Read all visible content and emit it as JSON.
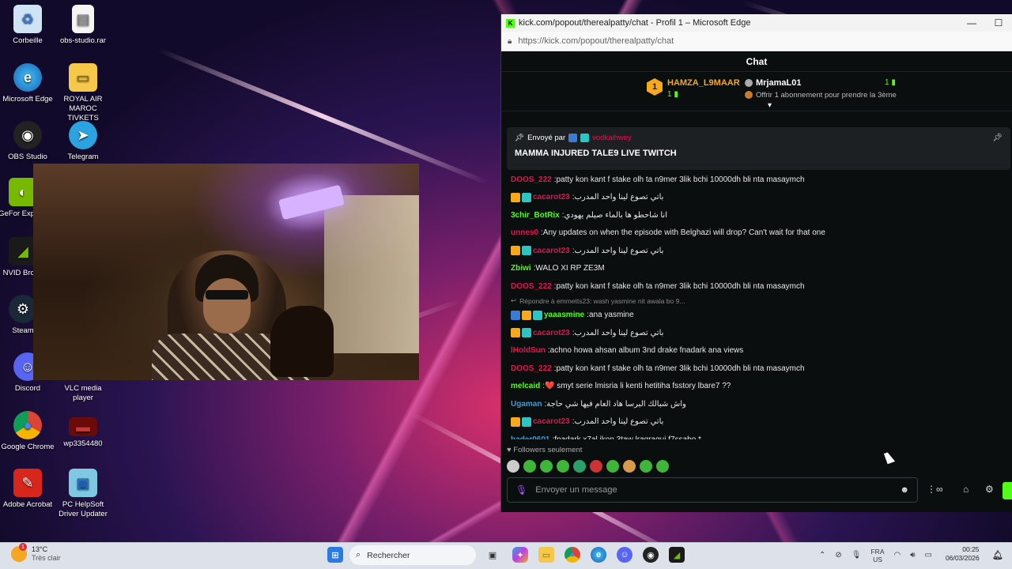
{
  "desktop_icons": [
    {
      "label": "Corbeille"
    },
    {
      "label": "obs-studio.rar"
    },
    {
      "label": "Microsoft Edge"
    },
    {
      "label": "ROYAL AIR MAROC TIVKETS"
    },
    {
      "label": "OBS Studio"
    },
    {
      "label": "Telegram"
    },
    {
      "label": "GeFor Experie"
    },
    {
      "label": "NVID Broad"
    },
    {
      "label": "Steam"
    },
    {
      "label": "Discord"
    },
    {
      "label": "VLC media player"
    },
    {
      "label": "Google Chrome"
    },
    {
      "label": "wp3354480"
    },
    {
      "label": "Adobe Acrobat"
    },
    {
      "label": "PC HelpSoft Driver Updater"
    }
  ],
  "window": {
    "title": "kick.com/popout/therealpatty/chat - Profil 1 – Microsoft Edge",
    "url": "https://kick.com/popout/therealpatty/chat",
    "minimize": "—",
    "maximize": "☐"
  },
  "chat": {
    "header": "Chat",
    "leaderboard": {
      "first_rank": "1",
      "first_name": "HAMZA_L9MAAR",
      "first_count": "1",
      "second_name": "MrjamaL01",
      "second_count": "1",
      "offer_text": "Offrir 1 abonnement pour prendre la 3ème"
    },
    "pinned": {
      "sent_by": "Envoyé par",
      "user": "vodkaihwey",
      "message": "MAMMA INJURED TALE9 LIVE TWITCH"
    },
    "messages": [
      {
        "user": "DOOS_222",
        "color": "#e9114f",
        "badges": [],
        "text": "patty kon kant f stake olh ta n9mer 3lik bchi 10000dh bli nta masaymch"
      },
      {
        "user": "cacarot23",
        "color": "#e9114f",
        "badges": [
          "#f7a81b",
          "#2ec4c4"
        ],
        "text": "باتي تصوع لينا واحد المدرب"
      },
      {
        "user": "3chir_BotRix",
        "color": "#53fc18",
        "badges": [],
        "text": "انا شاحطو ها بالماء صيلم يهودي"
      },
      {
        "user": "unnes0",
        "color": "#e9114f",
        "badges": [],
        "text": "Any updates on when the episode with Belghazi will drop? Can't wait for that one"
      },
      {
        "user": "cacarot23",
        "color": "#e9114f",
        "badges": [
          "#f7a81b",
          "#2ec4c4"
        ],
        "text": "باتي تصوع لينا واحد المدرب"
      },
      {
        "user": "Zbiwi",
        "color": "#53fc18",
        "badges": [],
        "text": "WALO XI RP ZE3M"
      },
      {
        "user": "DOOS_222",
        "color": "#e9114f",
        "badges": [],
        "text": "patty kon kant f stake olh ta n9mer 3lik bchi 10000dh bli nta masaymch"
      }
    ],
    "reply_line": "Répondre à emmetts23: wash yasmine nit awala bo 9...",
    "messages2": [
      {
        "user": "yaaasmine",
        "color": "#53fc18",
        "badges": [
          "#3a7bd5",
          "#f7a81b",
          "#2ec4c4"
        ],
        "text": "ana yasmine"
      },
      {
        "user": "cacarot23",
        "color": "#e9114f",
        "badges": [
          "#f7a81b",
          "#2ec4c4"
        ],
        "text": "باتي تصوع لينا واحد المدرب"
      },
      {
        "user": "lHoldSun",
        "color": "#e9114f",
        "badges": [],
        "text": "achno howa ahsan album 3nd drake fnadark ana views"
      },
      {
        "user": "DOOS_222",
        "color": "#e9114f",
        "badges": [],
        "text": "patty kon kant f stake olh ta n9mer 3lik bchi 10000dh bli nta masaymch"
      },
      {
        "user": "melcaid",
        "color": "#53fc18",
        "badges": [],
        "text": " ❤️ smyt serie lmisria li kenti hetitiha fsstory lbare7 ??"
      },
      {
        "user": "Ugaman",
        "color": "#3a9bdc",
        "badges": [],
        "text": "واش شبالك البرسا هاد العام فيها شي حاجة"
      },
      {
        "user": "cacarot23",
        "color": "#e9114f",
        "badges": [
          "#f7a81b",
          "#2ec4c4"
        ],
        "text": "باتي تصوع لينا واحد المدرب"
      },
      {
        "user": "bader0601",
        "color": "#3a9bdc",
        "badges": [],
        "text": "fnadark x7al ikon 3taw lragragui f7ssabo *"
      }
    ],
    "followers_only": "Followers seulement",
    "input_placeholder": "Envoyer un message",
    "controls": {
      "emoji": "☻",
      "gifts": "⋮∞",
      "store": "⌂",
      "settings": "⚙"
    }
  },
  "taskbar": {
    "temperature": "13°C",
    "weather": "Très clair",
    "weather_alert": "1",
    "search_placeholder": "Rechercher",
    "lang1": "FRA",
    "lang2": "US",
    "time": "00:25",
    "date": "06/03/2026"
  }
}
